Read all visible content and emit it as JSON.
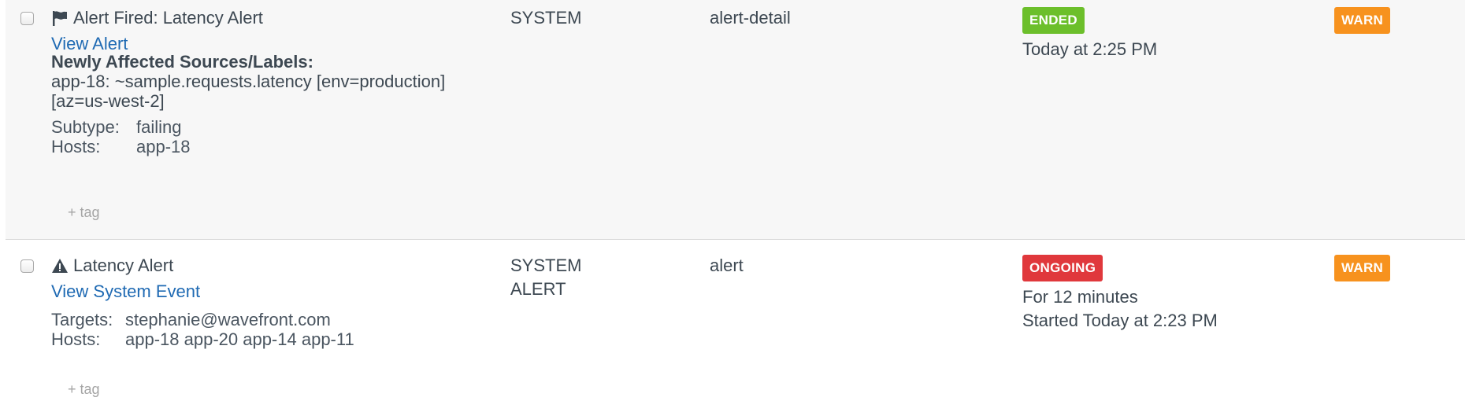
{
  "colors": {
    "link": "#1f6ab3",
    "ended": "#6cbf2b",
    "ongoing": "#e0383c",
    "warn": "#f7921e"
  },
  "events": [
    {
      "icon": "flag-icon",
      "title": "Alert Fired: Latency Alert",
      "link": "View Alert",
      "affected_heading": "Newly Affected Sources/Labels:",
      "affected_lines": [
        "app-18: ~sample.requests.latency [env=production]",
        "[az=us-west-2]"
      ],
      "details": [
        {
          "key": "Subtype:",
          "value": "failing"
        },
        {
          "key": "Hosts:",
          "value": "app-18"
        }
      ],
      "tag_button": "+ tag",
      "type_lines": [
        "SYSTEM"
      ],
      "name": "alert-detail",
      "status": "ENDED",
      "time_lines": [
        "Today at 2:25 PM"
      ],
      "severity": "WARN"
    },
    {
      "icon": "warning-icon",
      "title": "Latency Alert",
      "link": "View System Event",
      "details": [
        {
          "key": "Targets:",
          "value": "stephanie@wavefront.com"
        },
        {
          "key": "Hosts:",
          "value": "app-18 app-20 app-14 app-11"
        }
      ],
      "tag_button": "+ tag",
      "type_lines": [
        "SYSTEM",
        "ALERT"
      ],
      "name": "alert",
      "status": "ONGOING",
      "time_lines": [
        "For 12 minutes",
        "Started Today at 2:23 PM"
      ],
      "severity": "WARN"
    }
  ]
}
